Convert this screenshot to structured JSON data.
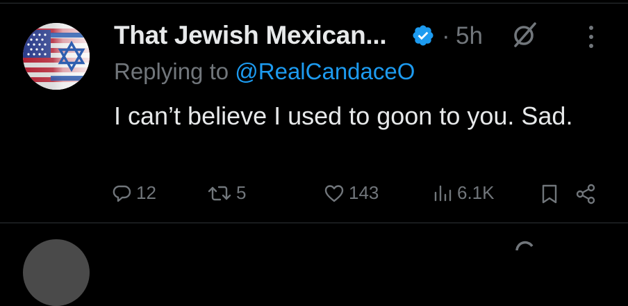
{
  "tweet": {
    "display_name": "That Jewish Mexican...",
    "separator": "·",
    "time": "5h",
    "replying_prefix": "Replying to ",
    "replying_handle": "@RealCandaceO",
    "text": "I can’t believe I used to goon to you. Sad.",
    "icons": {
      "verified": "verified-badge-icon",
      "grok": "grok-icon",
      "more": "more-options-icon"
    },
    "colors": {
      "background": "#000000",
      "text": "#e7e9ea",
      "secondary": "#71767b",
      "accent": "#1d9bf0",
      "divider": "#2f3336"
    }
  },
  "actions": {
    "reply_count": "12",
    "retweet_count": "5",
    "like_count": "143",
    "views_count": "6.1K"
  }
}
